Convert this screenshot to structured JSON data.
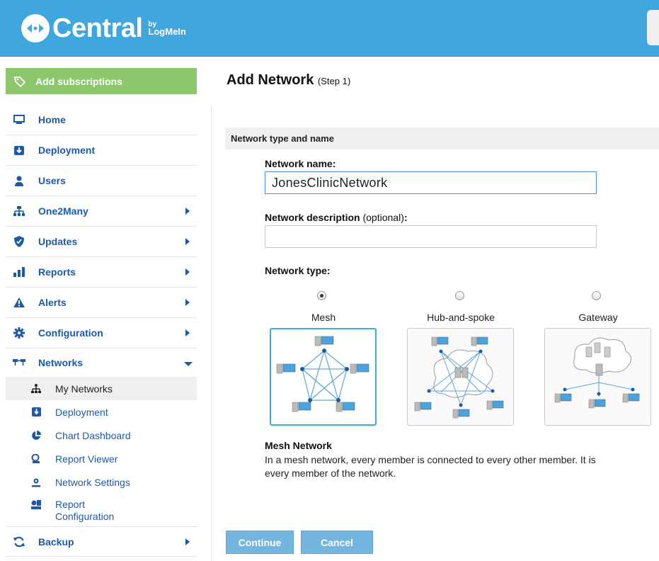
{
  "brand": {
    "name": "Central",
    "by": "by",
    "company": "LogMeIn"
  },
  "sidebar": {
    "add_subscriptions": "Add subscriptions",
    "items": [
      {
        "label": "Home",
        "icon": "monitor-icon"
      },
      {
        "label": "Deployment",
        "icon": "download-icon"
      },
      {
        "label": "Users",
        "icon": "user-icon"
      },
      {
        "label": "One2Many",
        "icon": "hierarchy-icon"
      },
      {
        "label": "Updates",
        "icon": "shield-icon"
      },
      {
        "label": "Reports",
        "icon": "bar-chart-icon"
      },
      {
        "label": "Alerts",
        "icon": "warning-icon"
      },
      {
        "label": "Configuration",
        "icon": "gear-icon"
      },
      {
        "label": "Networks",
        "icon": "network-icon"
      },
      {
        "label": "Backup",
        "icon": "refresh-icon"
      }
    ],
    "networks_sub": [
      {
        "label": "My Networks",
        "icon": "network-tree-icon"
      },
      {
        "label": "Deployment",
        "icon": "download-icon"
      },
      {
        "label": "Chart Dashboard",
        "icon": "pie-chart-icon"
      },
      {
        "label": "Report Viewer",
        "icon": "report-viewer-icon"
      },
      {
        "label": "Network Settings",
        "icon": "settings-icon"
      },
      {
        "label": "Report Configuration",
        "icon": "report-config-icon"
      }
    ]
  },
  "main": {
    "title": "Add Network",
    "step": "(Step 1)",
    "section": "Network type and name",
    "name_label": "Network name:",
    "name_value": "JonesClinicNetwork",
    "desc_label": "Network description",
    "desc_optional": "(optional)",
    "desc_colon": ":",
    "desc_value": "",
    "type_label": "Network type:",
    "types": [
      {
        "label": "Mesh",
        "selected": true
      },
      {
        "label": "Hub-and-spoke",
        "selected": false
      },
      {
        "label": "Gateway",
        "selected": false
      }
    ],
    "info_title": "Mesh Network",
    "info_line1": "In a mesh network, every member is connected to every other member. It is",
    "info_line2": "every member of the network.",
    "continue": "Continue",
    "cancel": "Cancel"
  },
  "colors": {
    "header": "#3fa7dd",
    "subscriptions": "#8cc76e",
    "nav_text": "#1c5aa8",
    "button": "#74b5e0"
  }
}
